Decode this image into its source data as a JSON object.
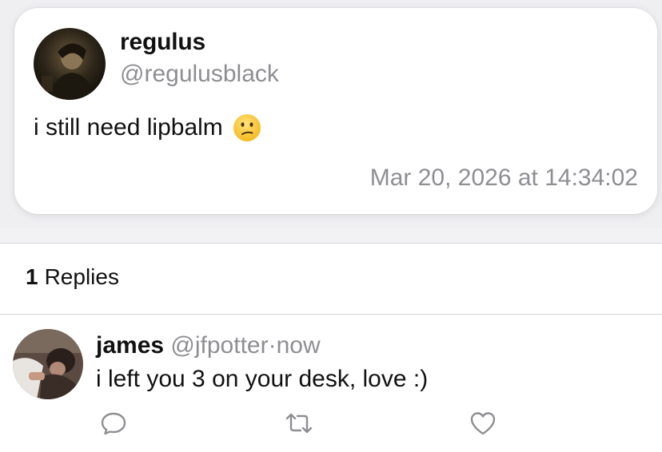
{
  "post": {
    "author_name": "regulus",
    "author_handle": "@regulusblack",
    "text": "i still need lipbalm",
    "emoji": "confused-face-emoji",
    "timestamp": "Mar 20, 2026 at 14:34:02"
  },
  "replies": {
    "count": "1",
    "label": "Replies",
    "items": [
      {
        "name": "james",
        "handle": "@jfpotter",
        "separator": "·",
        "time": "now",
        "text": "i left you 3 on your desk, love :)"
      }
    ]
  },
  "icons": {
    "reply": "comment-icon",
    "retweet": "retweet-icon",
    "like": "heart-icon"
  },
  "colors": {
    "secondary_text": "#8e8e93",
    "divider": "#d4d4d8",
    "card_background": "#ffffff"
  }
}
